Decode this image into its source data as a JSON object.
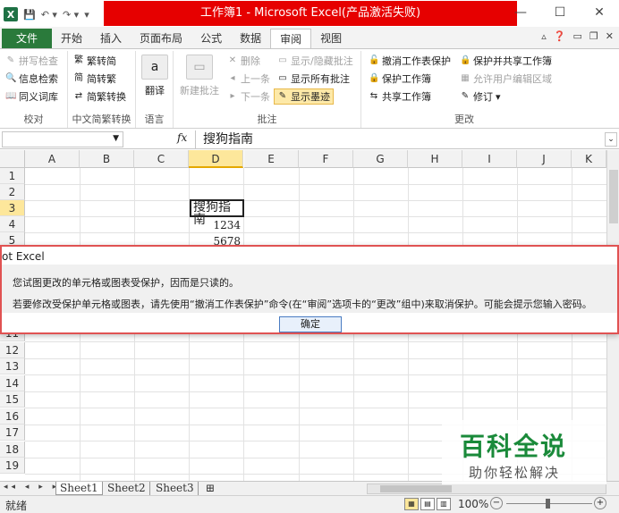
{
  "window": {
    "title": "工作簿1 - Microsoft Excel(产品激活失败)",
    "app_icon": "X",
    "controls": [
      "—",
      "☐",
      "✕"
    ]
  },
  "ribbon_tabs": [
    "文件",
    "开始",
    "插入",
    "页面布局",
    "公式",
    "数据",
    "审阅",
    "视图"
  ],
  "active_tab": "审阅",
  "ribbon": {
    "proofing": {
      "label": "校对",
      "items": [
        "拼写检查",
        "信息检索",
        "同义词库"
      ]
    },
    "chinese": {
      "label": "中文简繁转换",
      "items": [
        "繁转简",
        "简转繁",
        "简繁转换"
      ]
    },
    "language": {
      "label": "语言",
      "translate": "翻译"
    },
    "comments": {
      "label": "批注",
      "new": "新建批注",
      "delete": "删除",
      "prev": "上一条",
      "next": "下一条",
      "show_hide": "显示/隐藏批注",
      "show_all": "显示所有批注",
      "show_ink": "显示墨迹"
    },
    "changes": {
      "label": "更改",
      "unprotect_sheet": "撤消工作表保护",
      "protect_workbook": "保护工作簿",
      "share_workbook": "共享工作簿",
      "protect_share": "保护并共享工作簿",
      "allow_edit": "允许用户编辑区域",
      "track": "修订"
    }
  },
  "formula_bar": {
    "fx": "fx",
    "content": "搜狗指南"
  },
  "columns": [
    "A",
    "B",
    "C",
    "D",
    "E",
    "F",
    "G",
    "H",
    "I",
    "J",
    "K"
  ],
  "rows_top": [
    "1",
    "2",
    "3",
    "4",
    "5"
  ],
  "rows_bottom": [
    "11",
    "12",
    "13",
    "14",
    "15",
    "16",
    "17",
    "18",
    "19"
  ],
  "cells": {
    "D3": "搜狗指南",
    "D4": "1234",
    "D5": "5678"
  },
  "dialog": {
    "title": "ot Excel",
    "line1": "您试图更改的单元格或图表受保护，因而是只读的。",
    "line2": "若要修改受保护单元格或图表，请先使用“撤消工作表保护”命令(在“审阅”选项卡的“更改”组中)来取消保护。可能会提示您输入密码。",
    "ok": "确定"
  },
  "sheets": [
    "Sheet1",
    "Sheet2",
    "Sheet3"
  ],
  "status": {
    "ready": "就绪",
    "zoom": "100%"
  },
  "watermark": {
    "title": "百科全说",
    "subtitle": "助你轻松解决"
  }
}
